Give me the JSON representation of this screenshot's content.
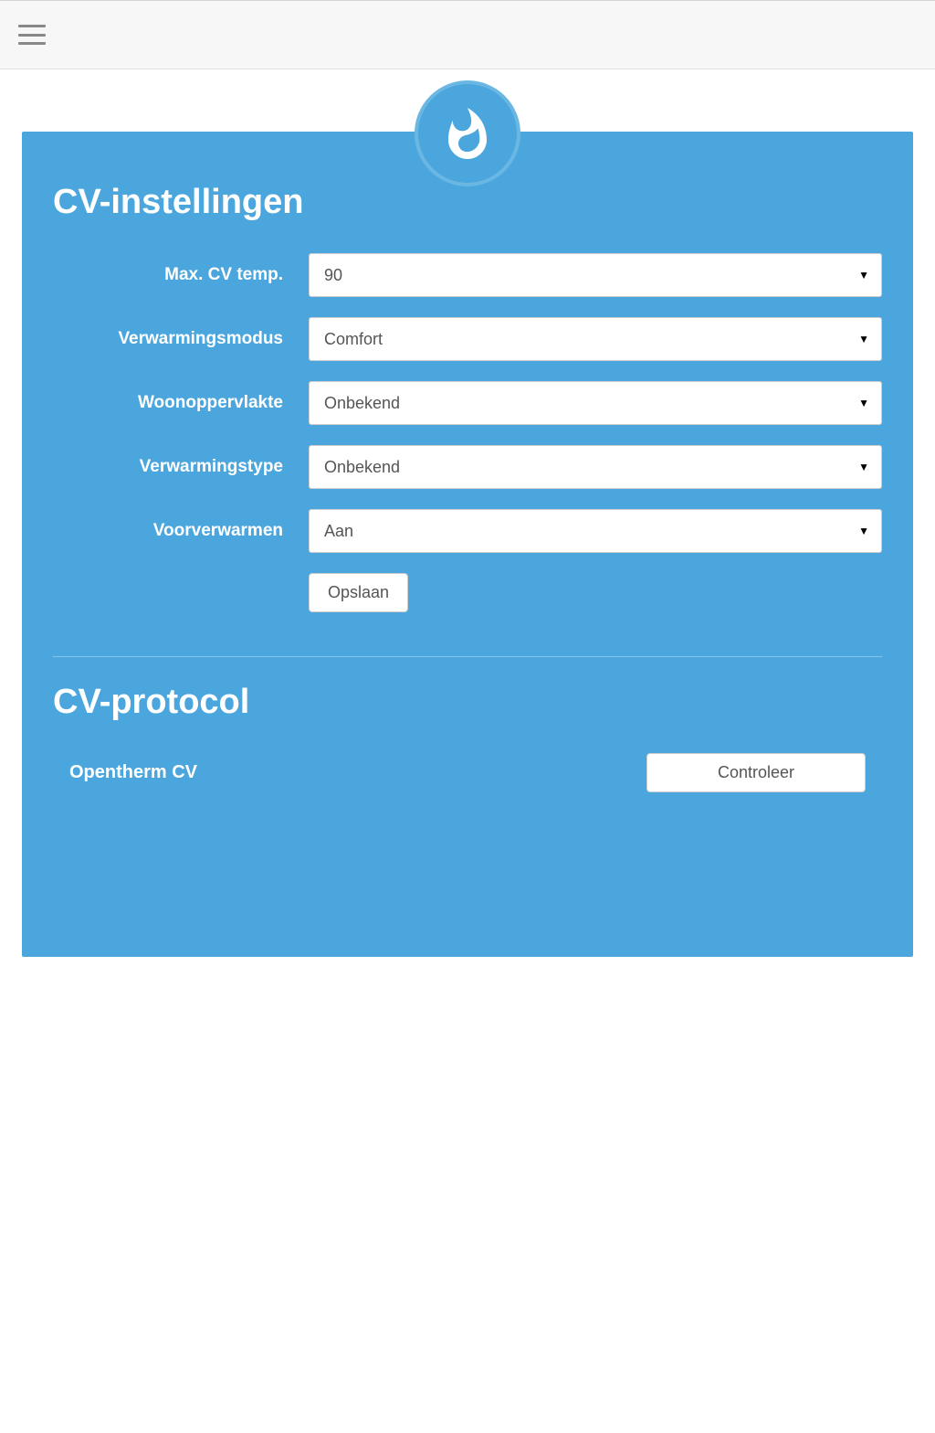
{
  "settings": {
    "title": "CV-instellingen",
    "fields": {
      "max_cv_temp": {
        "label": "Max. CV temp.",
        "value": "90"
      },
      "heating_mode": {
        "label": "Verwarmingsmodus",
        "value": "Comfort"
      },
      "living_area": {
        "label": "Woonoppervlakte",
        "value": "Onbekend"
      },
      "heating_type": {
        "label": "Verwarmingstype",
        "value": "Onbekend"
      },
      "preheat": {
        "label": "Voorverwarmen",
        "value": "Aan"
      }
    },
    "save_label": "Opslaan"
  },
  "protocol": {
    "title": "CV-protocol",
    "label": "Opentherm CV",
    "check_label": "Controleer"
  }
}
